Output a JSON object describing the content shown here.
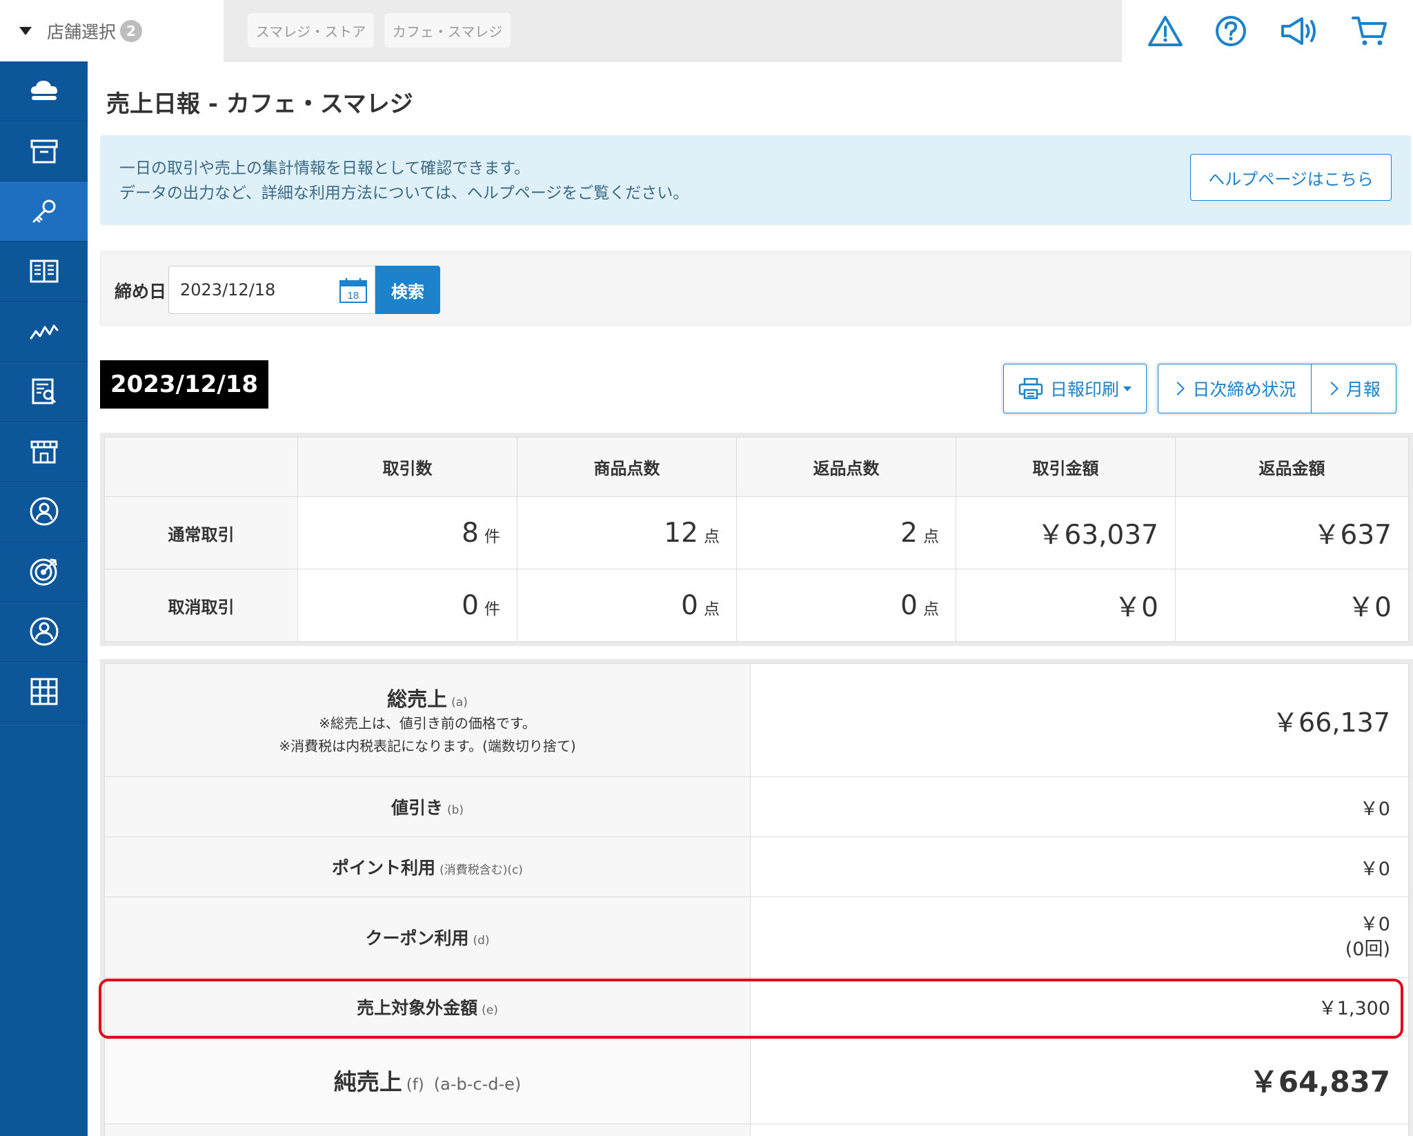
{
  "topbar": {
    "store_select_label": "店舗選択",
    "store_count": "2",
    "store_tabs": [
      "スマレジ・ストア",
      "カフェ・スマレジ"
    ],
    "icons": [
      "warning-icon",
      "help-icon",
      "megaphone-icon",
      "cart-icon"
    ]
  },
  "sidebar": {
    "icons": [
      "cloud-icon",
      "archive-box-icon",
      "key-icon",
      "book-icon",
      "chart-line-icon",
      "report-icon",
      "store-icon",
      "user-circle-icon",
      "target-icon",
      "user-icon",
      "apps-grid-icon"
    ],
    "active_index": 2
  },
  "page": {
    "title": "売上日報 - カフェ・スマレジ"
  },
  "info": {
    "line1": "一日の取引や売上の集計情報を日報として確認できます。",
    "line2": "データの出力など、詳細な利用方法については、ヘルプページをご覧ください。",
    "help_button": "ヘルプページはこちら"
  },
  "search": {
    "label": "締め日",
    "date_value": "2023/12/18",
    "calendar_day": "18",
    "button": "検索"
  },
  "report": {
    "date_badge": "2023/12/18",
    "print_button": "日報印刷",
    "closing_status_button": "日次締め状況",
    "monthly_button": "月報"
  },
  "summary_table": {
    "headers": [
      "取引数",
      "商品点数",
      "返品点数",
      "取引金額",
      "返品金額"
    ],
    "rows": [
      {
        "label": "通常取引",
        "transactions": "8",
        "transactions_unit": "件",
        "items": "12",
        "items_unit": "点",
        "returns": "2",
        "returns_unit": "点",
        "amount": "￥63,037",
        "return_amount": "￥637"
      },
      {
        "label": "取消取引",
        "transactions": "0",
        "transactions_unit": "件",
        "items": "0",
        "items_unit": "点",
        "returns": "0",
        "returns_unit": "点",
        "amount": "￥0",
        "return_amount": "￥0"
      }
    ]
  },
  "sales_table": {
    "gross": {
      "label": "総売上",
      "sub": "(a)",
      "note1": "※総売上は、値引き前の価格です。",
      "note2": "※消費税は内税表記になります。(端数切り捨て)",
      "value": "￥66,137"
    },
    "discount": {
      "label": "値引き",
      "sub": "(b)",
      "value": "￥0"
    },
    "points": {
      "label": "ポイント利用",
      "sub": "(消費税含む)(c)",
      "value": "￥0"
    },
    "coupon": {
      "label": "クーポン利用",
      "sub": "(d)",
      "value": "￥0",
      "count": "(0回)"
    },
    "non_sales": {
      "label": "売上対象外金額",
      "sub": "(e)",
      "value": "￥1,300"
    },
    "net": {
      "label": "純売上",
      "sub": "(f)",
      "formula": "(a-b-c-d-e)",
      "value": "￥64,837"
    }
  }
}
